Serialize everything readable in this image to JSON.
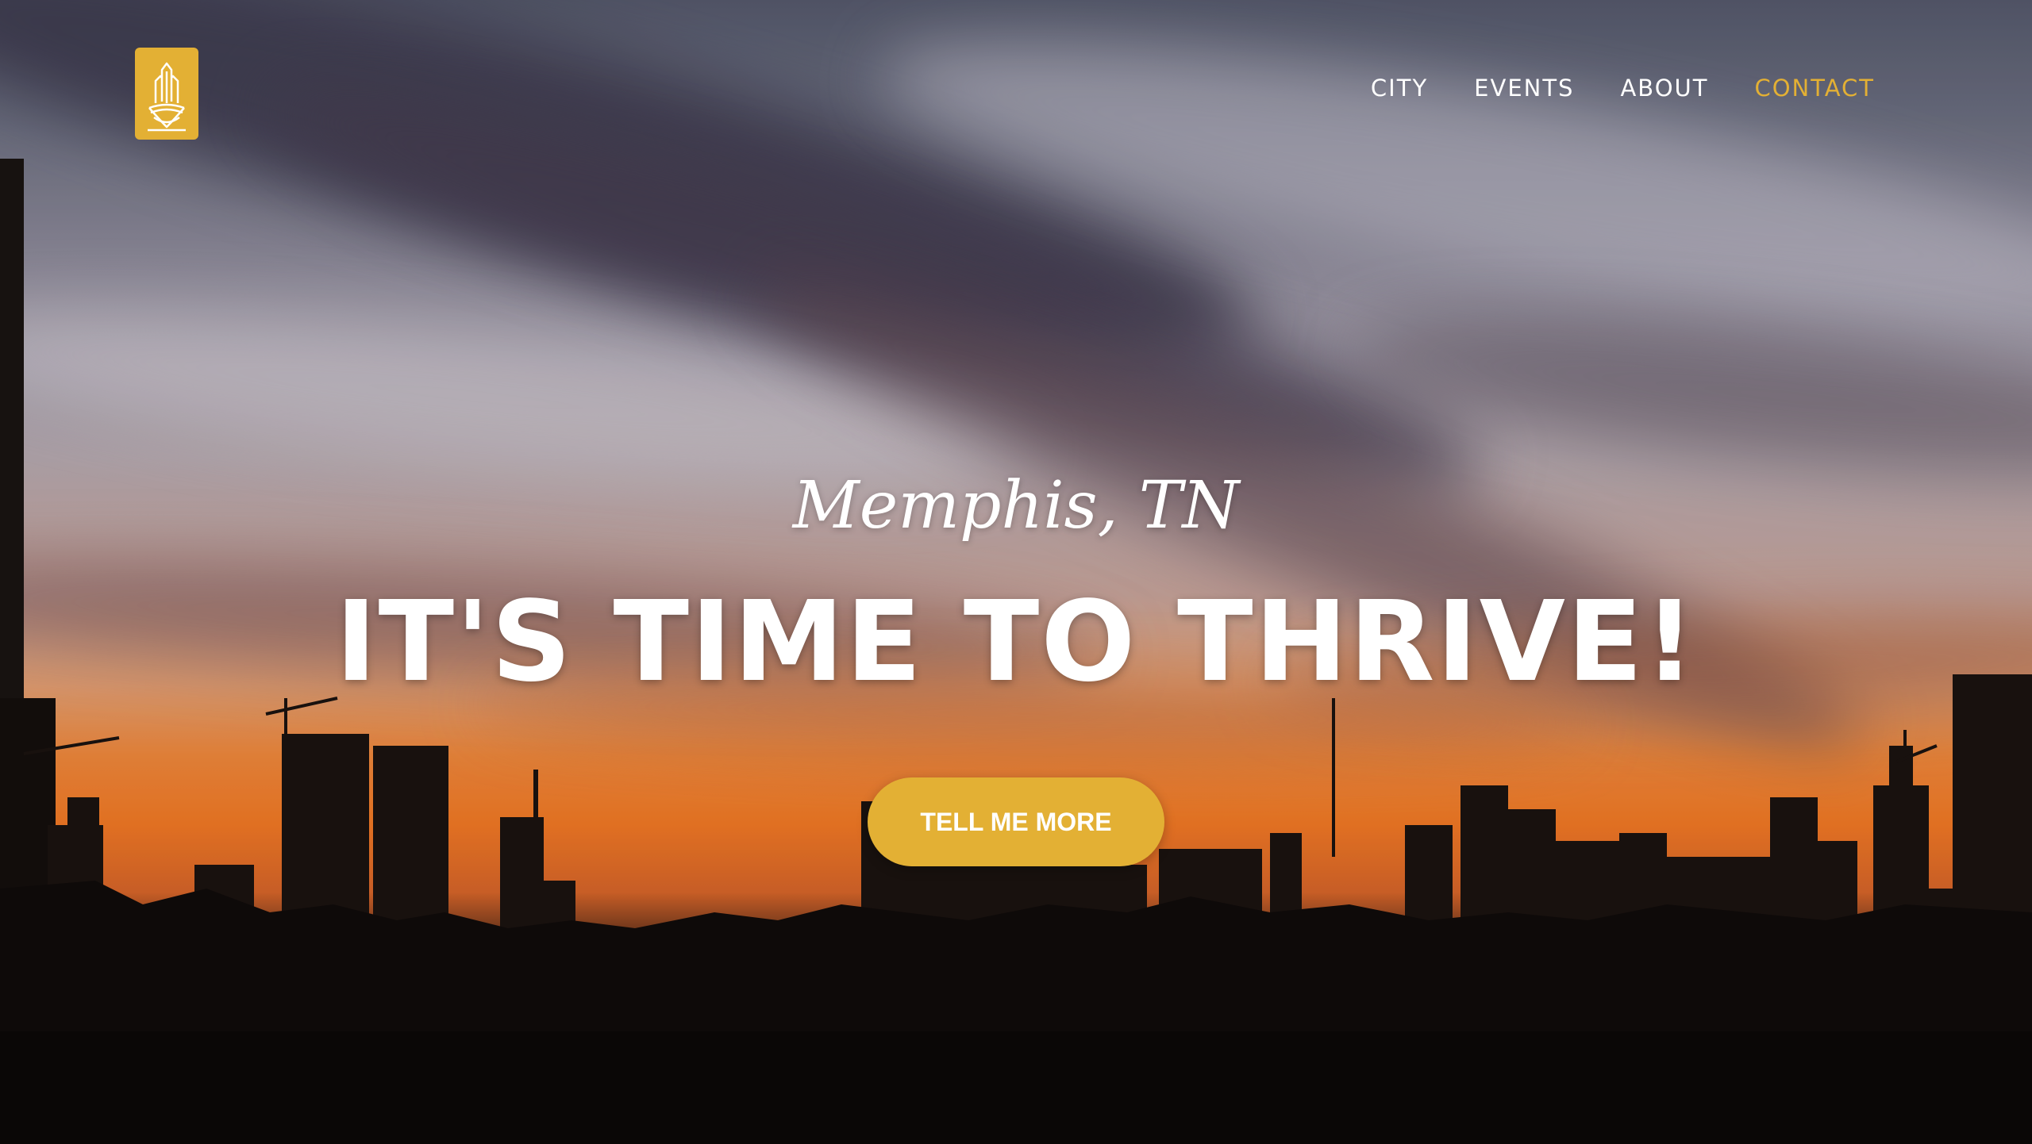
{
  "brand": {
    "logo_icon": "building-skyline-icon",
    "accent_color": "#e3b034"
  },
  "nav": {
    "items": [
      {
        "label": "CITY"
      },
      {
        "label": "EVENTS"
      },
      {
        "label": "ABOUT"
      },
      {
        "label": "CONTACT",
        "active": true
      }
    ]
  },
  "hero": {
    "subtitle": "Memphis, TN",
    "headline": "IT'S TIME TO THRIVE!",
    "cta_label": "TELL ME MORE",
    "background": "sunset-city-skyline-photo"
  }
}
